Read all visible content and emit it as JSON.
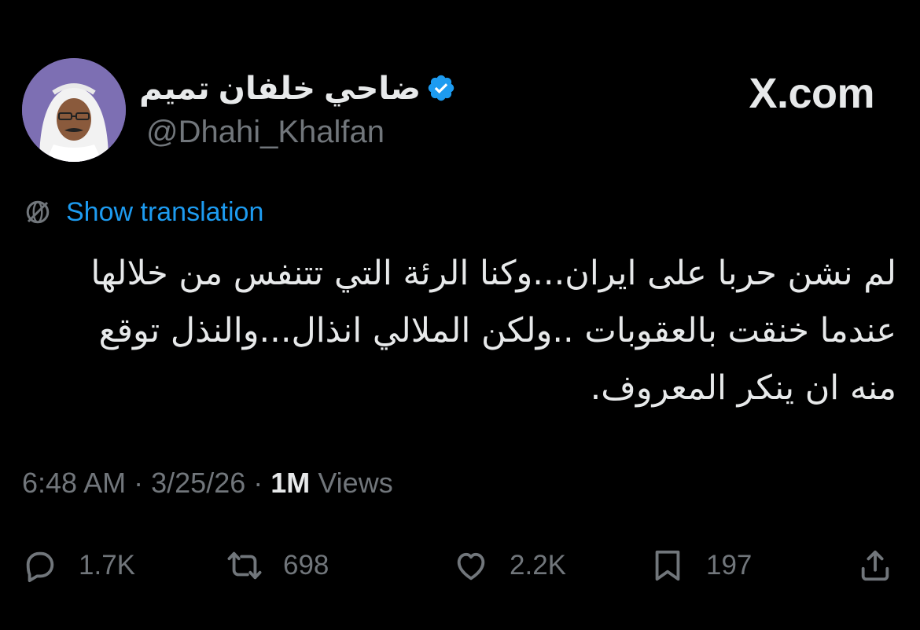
{
  "site_label": "X.com",
  "author": {
    "display_name": "ضاحي خلفان تميم",
    "handle": "@Dhahi_Khalfan",
    "avatar": "avatar-photo",
    "verified_icon": "verified-badge-icon",
    "verified_color": "#1d9bf0"
  },
  "translation": {
    "icon": "globe-icon",
    "label": "Show translation",
    "color": "#1d9bf0"
  },
  "tweet": {
    "lines": [
      "لم نشن حربا على ايران...وكنا الرئة التي تتنفس من خلالها",
      "عندما خنقت بالعقوبات ..ولكن الملالي انذال...والنذل توقع",
      "منه ان ينكر المعروف."
    ]
  },
  "meta": {
    "time": "6:48 AM",
    "separator": "·",
    "date": "3/25/26",
    "views_count": "1M",
    "views_label": "Views"
  },
  "actions": {
    "reply": {
      "icon": "reply-icon",
      "count": "1.7K"
    },
    "retweet": {
      "icon": "retweet-icon",
      "count": "698"
    },
    "like": {
      "icon": "heart-icon",
      "count": "2.2K"
    },
    "bookmark": {
      "icon": "bookmark-icon",
      "count": "197"
    },
    "share": {
      "icon": "share-icon"
    }
  },
  "colors": {
    "background": "#000000",
    "text": "#e7e9ea",
    "muted": "#71767b",
    "accent": "#1d9bf0"
  }
}
